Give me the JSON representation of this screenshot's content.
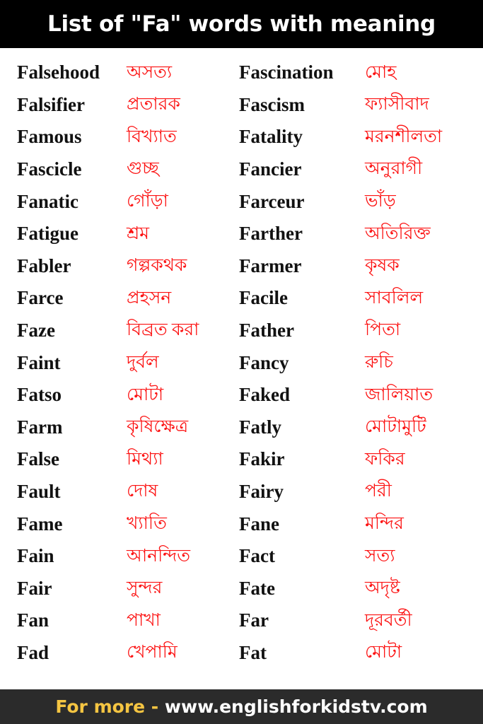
{
  "header": {
    "title": "List of \"Fa\" words with meaning",
    "background_color": "#000000",
    "text_color": "#ffffff"
  },
  "colors": {
    "english_word": "#111111",
    "bengali_meaning": "#fc1111",
    "page_background": "#ffffff",
    "footer_background": "#2b2b2b",
    "footer_accent": "#f5c542"
  },
  "word_list": {
    "left_column": [
      {
        "english": "Falsehood",
        "bengali": "অসত্য"
      },
      {
        "english": "Falsifier",
        "bengali": "প্রতারক"
      },
      {
        "english": "Famous",
        "bengali": "বিখ্যাত"
      },
      {
        "english": "Fascicle",
        "bengali": "গুচ্ছ"
      },
      {
        "english": "Fanatic",
        "bengali": "গোঁড়া"
      },
      {
        "english": "Fatigue",
        "bengali": "শ্রম"
      },
      {
        "english": "Fabler",
        "bengali": "গল্পকথক"
      },
      {
        "english": "Farce",
        "bengali": "প্রহসন"
      },
      {
        "english": "Faze",
        "bengali": "বিব্রত করা"
      },
      {
        "english": "Faint",
        "bengali": "দুর্বল"
      },
      {
        "english": "Fatso",
        "bengali": "মোটা"
      },
      {
        "english": "Farm",
        "bengali": "কৃষিক্ষেত্র"
      },
      {
        "english": "False",
        "bengali": "মিথ্যা"
      },
      {
        "english": "Fault",
        "bengali": "দোষ"
      },
      {
        "english": "Fame",
        "bengali": "খ্যাতি"
      },
      {
        "english": "Fain",
        "bengali": "আনন্দিত"
      },
      {
        "english": "Fair",
        "bengali": "সুন্দর"
      },
      {
        "english": "Fan",
        "bengali": "পাখা"
      },
      {
        "english": "Fad",
        "bengali": "খেপামি"
      }
    ],
    "right_column": [
      {
        "english": "Fascination",
        "bengali": "মোহ"
      },
      {
        "english": "Fascism",
        "bengali": "ফ্যাসীবাদ"
      },
      {
        "english": "Fatality",
        "bengali": "মরনশীলতা"
      },
      {
        "english": "Fancier",
        "bengali": "অনুরাগী"
      },
      {
        "english": "Farceur",
        "bengali": "ভাঁড়"
      },
      {
        "english": "Farther",
        "bengali": "অতিরিক্ত"
      },
      {
        "english": "Farmer",
        "bengali": "কৃষক"
      },
      {
        "english": "Facile",
        "bengali": "সাবলিল"
      },
      {
        "english": "Father",
        "bengali": "পিতা"
      },
      {
        "english": "Fancy",
        "bengali": "রুচি"
      },
      {
        "english": "Faked",
        "bengali": "জালিয়াত"
      },
      {
        "english": "Fatly",
        "bengali": "মোটামুটি"
      },
      {
        "english": "Fakir",
        "bengali": "ফকির"
      },
      {
        "english": "Fairy",
        "bengali": "পরী"
      },
      {
        "english": "Fane",
        "bengali": "মন্দির"
      },
      {
        "english": "Fact",
        "bengali": "সত্য"
      },
      {
        "english": "Fate",
        "bengali": "অদৃষ্ট"
      },
      {
        "english": "Far",
        "bengali": "দূরবর্তী"
      },
      {
        "english": "Fat",
        "bengali": "মোটা"
      }
    ]
  },
  "footer": {
    "label": "For more -",
    "url": "www.englishforkidstv.com"
  }
}
